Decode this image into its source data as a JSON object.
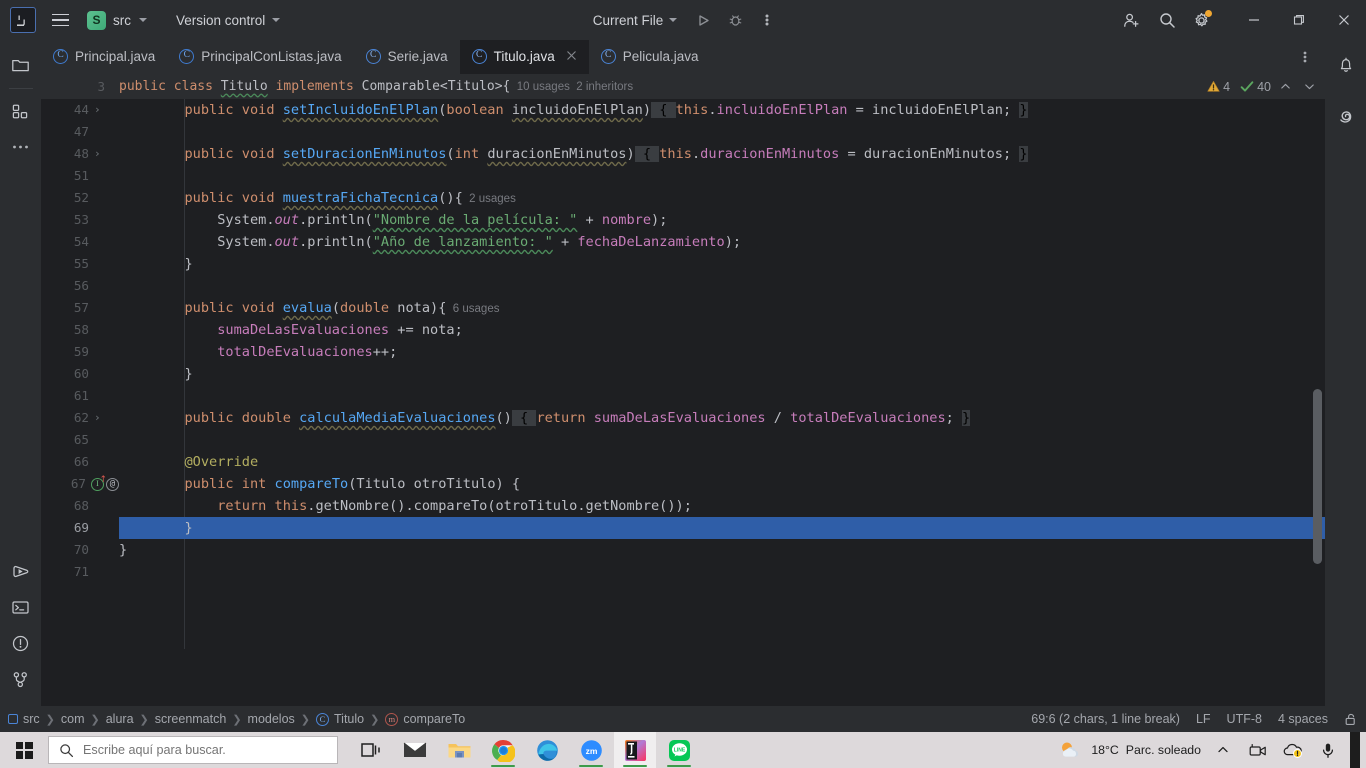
{
  "window": {
    "app_logo": "IJ",
    "project_initial": "S",
    "project_name": "src",
    "vcs_label": "Version control",
    "run_config": "Current File",
    "icons": {
      "menu": "hamburger-menu-icon",
      "run": "run-icon",
      "debug": "debug-icon",
      "more": "more-vertical-icon",
      "add_user": "add-user-icon",
      "search": "search-icon",
      "settings": "settings-gear-icon",
      "minimize": "minimize-icon",
      "maximize": "maximize-icon",
      "close": "close-icon"
    }
  },
  "left_stripe": {
    "top": [
      {
        "name": "project-tool-window",
        "icon": "folder-icon"
      },
      {
        "name": "commit-tool-window",
        "icon": "structure-blocks-icon"
      },
      {
        "name": "more-tool-windows",
        "icon": "more-horizontal-icon"
      }
    ],
    "bottom": [
      {
        "name": "run-tool-window",
        "icon": "run-play-icon"
      },
      {
        "name": "terminal-tool-window",
        "icon": "terminal-icon"
      },
      {
        "name": "problems-tool-window",
        "icon": "warning-circle-icon"
      },
      {
        "name": "git-tool-window",
        "icon": "git-branch-icon"
      }
    ]
  },
  "right_stripe": [
    {
      "name": "notifications",
      "icon": "bell-icon"
    },
    {
      "name": "ai-assistant",
      "icon": "spiral-icon"
    }
  ],
  "tabs": [
    {
      "label": "Principal.java",
      "icon": "java-runnable-class-icon",
      "active": false,
      "closable": false
    },
    {
      "label": "PrincipalConListas.java",
      "icon": "java-runnable-class-icon",
      "active": false,
      "closable": false
    },
    {
      "label": "Serie.java",
      "icon": "java-class-icon",
      "active": false,
      "closable": false
    },
    {
      "label": "Titulo.java",
      "icon": "java-class-icon",
      "active": true,
      "closable": true
    },
    {
      "label": "Pelicula.java",
      "icon": "java-class-icon",
      "active": false,
      "closable": false
    }
  ],
  "tabbar_more_icon": "more-vertical-icon",
  "sticky_header": {
    "line_number": "3",
    "segments": [
      {
        "t": "public ",
        "c": "kw"
      },
      {
        "t": "class ",
        "c": "kw"
      },
      {
        "t": "Titulo",
        "c": "typ sq"
      },
      {
        "t": " ",
        "c": "pln"
      },
      {
        "t": "implements ",
        "c": "kw"
      },
      {
        "t": "Comparable<Titulo>{",
        "c": "pln"
      }
    ],
    "usages": "10 usages",
    "inheritors": "2 inheritors",
    "warnings_count": "4",
    "checks_count": "40",
    "warning_icon": "warning-triangle-icon",
    "check_icon": "check-mark-icon",
    "prev_icon": "chevron-up-icon",
    "next_icon": "chevron-down-icon"
  },
  "editor": {
    "selected_line": "69",
    "lines": [
      {
        "n": "44",
        "fold": true,
        "segments": [
          {
            "t": "        ",
            "c": "pln"
          },
          {
            "t": "public ",
            "c": "kw"
          },
          {
            "t": "void ",
            "c": "kw"
          },
          {
            "t": "setIncluidoEnElPlan",
            "c": "mthd sqw"
          },
          {
            "t": "(",
            "c": "pln"
          },
          {
            "t": "boolean ",
            "c": "kw"
          },
          {
            "t": "incluidoEnElPlan",
            "c": "pln sqw"
          },
          {
            "t": ")",
            "c": "pln"
          },
          {
            "t": " { ",
            "c": "brhl"
          },
          {
            "t": "this",
            "c": "kw"
          },
          {
            "t": ".",
            "c": "pln"
          },
          {
            "t": "incluidoEnElPlan",
            "c": "fld"
          },
          {
            "t": " = incluidoEnElPlan; ",
            "c": "pln"
          },
          {
            "t": "}",
            "c": "brhl"
          }
        ]
      },
      {
        "n": "47",
        "fold": false,
        "segments": []
      },
      {
        "n": "48",
        "fold": true,
        "segments": [
          {
            "t": "        ",
            "c": "pln"
          },
          {
            "t": "public ",
            "c": "kw"
          },
          {
            "t": "void ",
            "c": "kw"
          },
          {
            "t": "setDuracionEnMinutos",
            "c": "mthd sqw"
          },
          {
            "t": "(",
            "c": "pln"
          },
          {
            "t": "int ",
            "c": "kw"
          },
          {
            "t": "duracionEnMinutos",
            "c": "pln sqw"
          },
          {
            "t": ")",
            "c": "pln"
          },
          {
            "t": " { ",
            "c": "brhl"
          },
          {
            "t": "this",
            "c": "kw"
          },
          {
            "t": ".",
            "c": "pln"
          },
          {
            "t": "duracionEnMinutos",
            "c": "fld"
          },
          {
            "t": " = duracionEnMinutos; ",
            "c": "pln"
          },
          {
            "t": "}",
            "c": "brhl"
          }
        ]
      },
      {
        "n": "51",
        "fold": false,
        "segments": []
      },
      {
        "n": "52",
        "fold": false,
        "segments": [
          {
            "t": "        ",
            "c": "pln"
          },
          {
            "t": "public ",
            "c": "kw"
          },
          {
            "t": "void ",
            "c": "kw"
          },
          {
            "t": "muestraFichaTecnica",
            "c": "mthd sqw"
          },
          {
            "t": "(){",
            "c": "pln"
          },
          {
            "t": "  2 usages",
            "c": "hintt"
          }
        ]
      },
      {
        "n": "53",
        "fold": false,
        "segments": [
          {
            "t": "            ",
            "c": "pln"
          },
          {
            "t": "System",
            "c": "pln"
          },
          {
            "t": ".",
            "c": "pln"
          },
          {
            "t": "out",
            "c": "ital"
          },
          {
            "t": ".println(",
            "c": "pln"
          },
          {
            "t": "\"Nombre de la película: \"",
            "c": "str sq"
          },
          {
            "t": " + ",
            "c": "pln"
          },
          {
            "t": "nombre",
            "c": "fld"
          },
          {
            "t": ");",
            "c": "pln"
          }
        ]
      },
      {
        "n": "54",
        "fold": false,
        "segments": [
          {
            "t": "            ",
            "c": "pln"
          },
          {
            "t": "System",
            "c": "pln"
          },
          {
            "t": ".",
            "c": "pln"
          },
          {
            "t": "out",
            "c": "ital"
          },
          {
            "t": ".println(",
            "c": "pln"
          },
          {
            "t": "\"Año de lanzamiento: \"",
            "c": "str sq"
          },
          {
            "t": " + ",
            "c": "pln"
          },
          {
            "t": "fechaDeLanzamiento",
            "c": "fld"
          },
          {
            "t": ");",
            "c": "pln"
          }
        ]
      },
      {
        "n": "55",
        "fold": false,
        "segments": [
          {
            "t": "        }",
            "c": "pln"
          }
        ]
      },
      {
        "n": "56",
        "fold": false,
        "segments": []
      },
      {
        "n": "57",
        "fold": false,
        "segments": [
          {
            "t": "        ",
            "c": "pln"
          },
          {
            "t": "public ",
            "c": "kw"
          },
          {
            "t": "void ",
            "c": "kw"
          },
          {
            "t": "evalua",
            "c": "mthd sqw"
          },
          {
            "t": "(",
            "c": "pln"
          },
          {
            "t": "double ",
            "c": "kw"
          },
          {
            "t": "nota",
            "c": "pln"
          },
          {
            "t": "){",
            "c": "pln"
          },
          {
            "t": "  6 usages",
            "c": "hintt"
          }
        ]
      },
      {
        "n": "58",
        "fold": false,
        "segments": [
          {
            "t": "            ",
            "c": "pln"
          },
          {
            "t": "sumaDeLasEvaluaciones",
            "c": "fld"
          },
          {
            "t": " += nota;",
            "c": "pln"
          }
        ]
      },
      {
        "n": "59",
        "fold": false,
        "segments": [
          {
            "t": "            ",
            "c": "pln"
          },
          {
            "t": "totalDeEvaluaciones",
            "c": "fld"
          },
          {
            "t": "++;",
            "c": "pln"
          }
        ]
      },
      {
        "n": "60",
        "fold": false,
        "segments": [
          {
            "t": "        }",
            "c": "pln"
          }
        ]
      },
      {
        "n": "61",
        "fold": false,
        "segments": []
      },
      {
        "n": "62",
        "fold": true,
        "segments": [
          {
            "t": "        ",
            "c": "pln"
          },
          {
            "t": "public ",
            "c": "kw"
          },
          {
            "t": "double ",
            "c": "kw"
          },
          {
            "t": "calculaMediaEvaluaciones",
            "c": "mthd sqw"
          },
          {
            "t": "()",
            "c": "pln"
          },
          {
            "t": " { ",
            "c": "brhl"
          },
          {
            "t": "return ",
            "c": "kw"
          },
          {
            "t": "sumaDeLasEvaluaciones",
            "c": "fld"
          },
          {
            "t": " / ",
            "c": "pln"
          },
          {
            "t": "totalDeEvaluaciones",
            "c": "fld"
          },
          {
            "t": "; ",
            "c": "pln"
          },
          {
            "t": "}",
            "c": "brhl"
          }
        ]
      },
      {
        "n": "65",
        "fold": false,
        "segments": []
      },
      {
        "n": "66",
        "fold": false,
        "segments": [
          {
            "t": "        ",
            "c": "pln"
          },
          {
            "t": "@Override",
            "c": "ann"
          }
        ]
      },
      {
        "n": "67",
        "fold": false,
        "gutter_icons": [
          "implements-icon",
          "override-icon"
        ],
        "segments": [
          {
            "t": "        ",
            "c": "pln"
          },
          {
            "t": "public ",
            "c": "kw"
          },
          {
            "t": "int ",
            "c": "kw"
          },
          {
            "t": "compareTo",
            "c": "mth"
          },
          {
            "t": "(Titulo otroTitulo) {",
            "c": "pln"
          }
        ]
      },
      {
        "n": "68",
        "fold": false,
        "segments": [
          {
            "t": "            ",
            "c": "pln"
          },
          {
            "t": "return ",
            "c": "kw"
          },
          {
            "t": "this",
            "c": "kw"
          },
          {
            "t": ".getNombre().compareTo(otroTitulo.getNombre());",
            "c": "pln"
          }
        ]
      },
      {
        "n": "69",
        "fold": false,
        "selected": true,
        "segments": [
          {
            "t": "        }",
            "c": "pln"
          }
        ]
      },
      {
        "n": "70",
        "fold": false,
        "segments": [
          {
            "t": "}",
            "c": "pln"
          }
        ]
      },
      {
        "n": "71",
        "fold": false,
        "segments": []
      }
    ]
  },
  "status_bar": {
    "breadcrumbs": [
      {
        "label": "src",
        "icon": "module-icon"
      },
      {
        "label": "com",
        "icon": null
      },
      {
        "label": "alura",
        "icon": null
      },
      {
        "label": "screenmatch",
        "icon": null
      },
      {
        "label": "modelos",
        "icon": null
      },
      {
        "label": "Titulo",
        "icon": "java-class-icon"
      },
      {
        "label": "compareTo",
        "icon": "java-method-icon"
      }
    ],
    "caret": "69:6 (2 chars, 1 line break)",
    "line_separator": "LF",
    "encoding": "UTF-8",
    "indent": "4 spaces",
    "lock_icon": "unlocked-padlock-icon"
  },
  "taskbar": {
    "start_icon": "windows-start-icon",
    "search_placeholder": "Escribe aquí para buscar.",
    "search_value": "",
    "search_icon": "search-icon",
    "taskview_icon": "task-view-icon",
    "apps": [
      {
        "name": "mail",
        "label": "Mail",
        "open": false
      },
      {
        "name": "file-explorer",
        "label": "Explorador de archivos",
        "open": false
      },
      {
        "name": "google-chrome",
        "label": "Google Chrome",
        "open": true
      },
      {
        "name": "microsoft-edge",
        "label": "Microsoft Edge",
        "open": false
      },
      {
        "name": "zoom",
        "label": "Zoom",
        "open": true
      },
      {
        "name": "intellij-idea",
        "label": "IntelliJ IDEA",
        "open": true,
        "active": true
      },
      {
        "name": "line",
        "label": "LINE",
        "open": true
      }
    ],
    "tray": {
      "weather_temp": "18°C",
      "weather_desc": "Parc. soleado",
      "weather_icon": "partly-sunny-icon",
      "expand_icon": "chevron-up-icon",
      "camera_icon": "camera-icon",
      "onedrive_icon": "onedrive-warning-icon",
      "mic_icon": "microphone-icon"
    }
  },
  "colors": {
    "toolbar_bg": "#2b2d30",
    "editor_bg": "#1e1f22",
    "selection": "#2f5ea8",
    "keyword": "#cf8e6d",
    "method": "#56a8f5",
    "field": "#c77dbb",
    "string": "#6aab73",
    "annotation": "#b3ae60",
    "accent_green": "#3faa78",
    "warning": "#f0a732"
  }
}
